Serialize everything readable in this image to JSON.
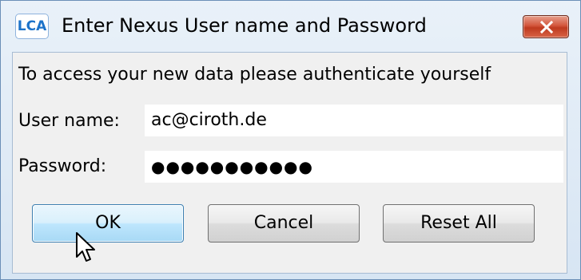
{
  "window": {
    "title": "Enter Nexus User name and Password",
    "app_icon_text": "LCA",
    "close_icon": "close-icon"
  },
  "dialog": {
    "message": "To access your new data please authenticate yourself",
    "user_name": {
      "label": "User name:",
      "value": "ac@ciroth.de"
    },
    "password": {
      "label": "Password:",
      "value_masked": "●●●●●●●●●●●"
    }
  },
  "buttons": {
    "ok": "OK",
    "cancel": "Cancel",
    "reset_all": "Reset All"
  },
  "colors": {
    "accent": "#3c7fb1",
    "close_button": "#c94a2c",
    "app_icon_text": "#1d73c9"
  }
}
